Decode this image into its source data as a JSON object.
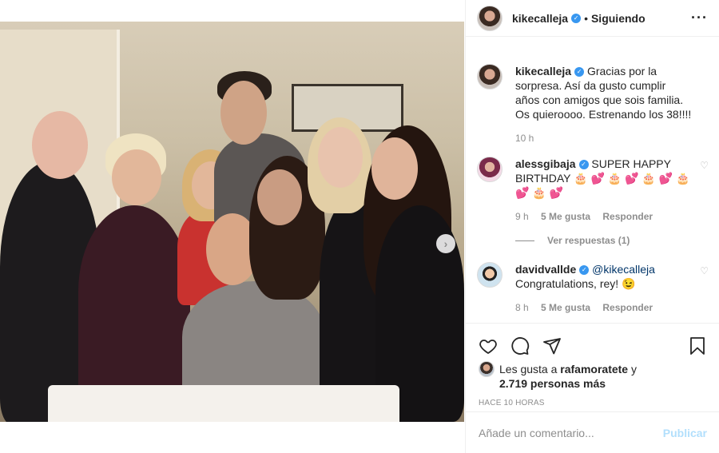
{
  "post": {
    "username": "kikecalleja",
    "follow_status": "Siguiendo",
    "dot": "•",
    "caption": "Gracias por la sorpresa. Así da gusto cumplir años con amigos que sois familia. Os quieroooo. Estrenando los 38!!!!",
    "caption_time": "10 h"
  },
  "comments": [
    {
      "username": "alessgibaja",
      "text": "SUPER HAPPY BIRTHDAY 🎂 💕 🎂 💕 🎂 💕 🎂 💕 🎂 💕",
      "time": "9 h",
      "likes": "5 Me gusta",
      "reply": "Responder",
      "view_replies": "Ver respuestas (1)"
    },
    {
      "username": "davidvallde",
      "mention": "@kikecalleja",
      "text": "Congratulations, rey! 😉",
      "time": "8 h",
      "likes": "5 Me gusta",
      "reply": "Responder"
    }
  ],
  "likes_line": {
    "prefix": "Les gusta a",
    "user": "rafamoratete",
    "connector": "y",
    "count": "2.719 personas más"
  },
  "ago": "HACE 10 HORAS",
  "composer": {
    "placeholder": "Añade un comentario...",
    "publish": "Publicar"
  },
  "icons": {
    "more": "more-options-icon",
    "like": "heart-icon",
    "comment": "comment-icon",
    "share": "share-icon",
    "save": "bookmark-icon",
    "next": "chevron-right-icon"
  },
  "colors": {
    "verified": "#3897f0",
    "publish_disabled": "#b2dffc",
    "muted": "#8e8e8e"
  }
}
